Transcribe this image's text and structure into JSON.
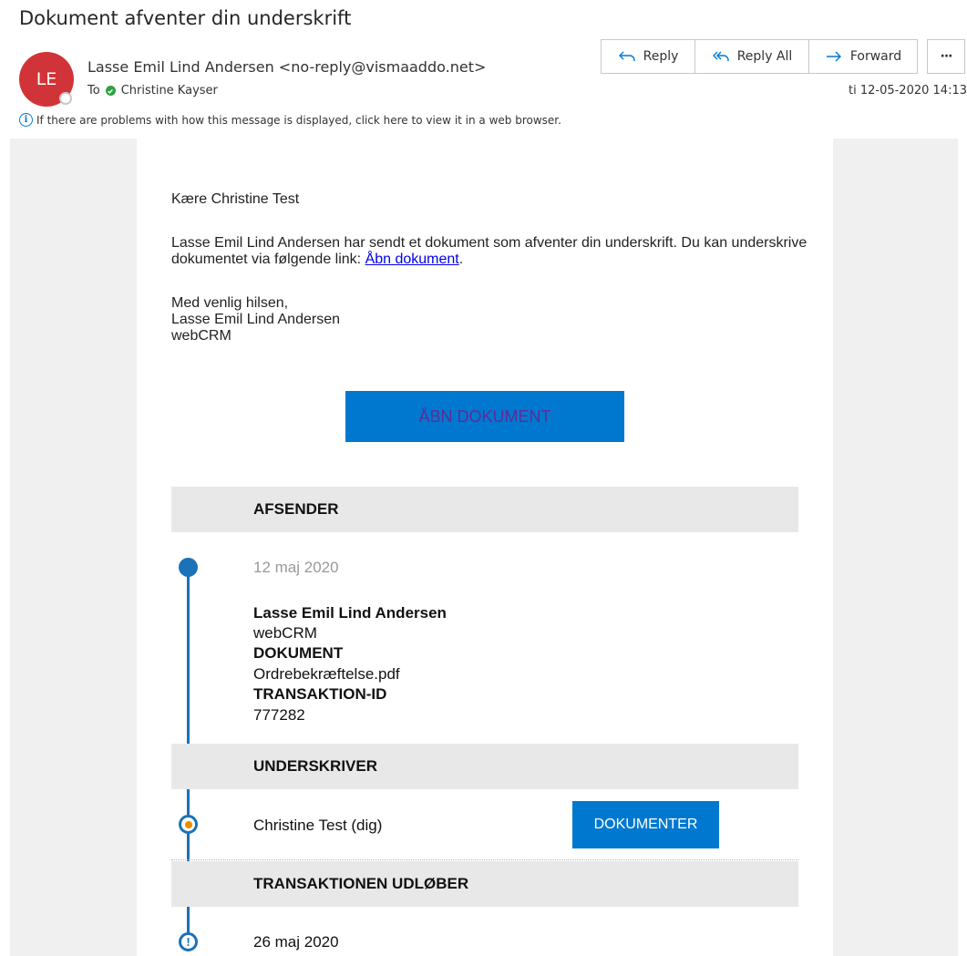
{
  "header": {
    "subject": "Dokument afventer din underskrift",
    "avatar_initials": "LE",
    "sender": "Lasse Emil Lind Andersen <no-reply@vismaaddo.net>",
    "to_label": "To",
    "recipient": "Christine Kayser",
    "date": "ti 12-05-2020 14:13",
    "info_text": "If there are problems with how this message is displayed, click here to view it in a web browser."
  },
  "actions": {
    "reply": "Reply",
    "reply_all": "Reply All",
    "forward": "Forward",
    "more": "···"
  },
  "email": {
    "greeting": "Kære Christine Test",
    "paragraph_before_link": "Lasse Emil Lind Andersen har sendt et dokument som afventer din underskrift. Du kan underskrive dokumentet via følgende link: ",
    "link_text": "Åbn dokument",
    "paragraph_after_link": ".",
    "closing": "Med venlig hilsen,",
    "signature_name": "Lasse Emil Lind Andersen",
    "signature_company": "webCRM",
    "cta_label": "ÅBN DOKUMENT"
  },
  "timeline": {
    "sender_heading": "AFSENDER",
    "sent_date": "12 maj 2020",
    "sender_name": "Lasse Emil Lind Andersen",
    "sender_company": "webCRM",
    "document_label": "DOKUMENT",
    "document_name": "Ordrebekræftelse.pdf",
    "transaction_label": "TRANSAKTION-ID",
    "transaction_id": "777282",
    "signer_heading": "UNDERSKRIVER",
    "signer_name": "Christine Test (dig)",
    "documents_button": "DOKUMENTER",
    "expiry_heading": "TRANSAKTIONEN UDLØBER",
    "expiry_date": "26 maj 2020",
    "expiry_icon": "!"
  },
  "colors": {
    "avatar": "#d13438",
    "accent_blue": "#0078d0",
    "timeline": "#1a72b8",
    "pending_dot": "#f08a00"
  }
}
